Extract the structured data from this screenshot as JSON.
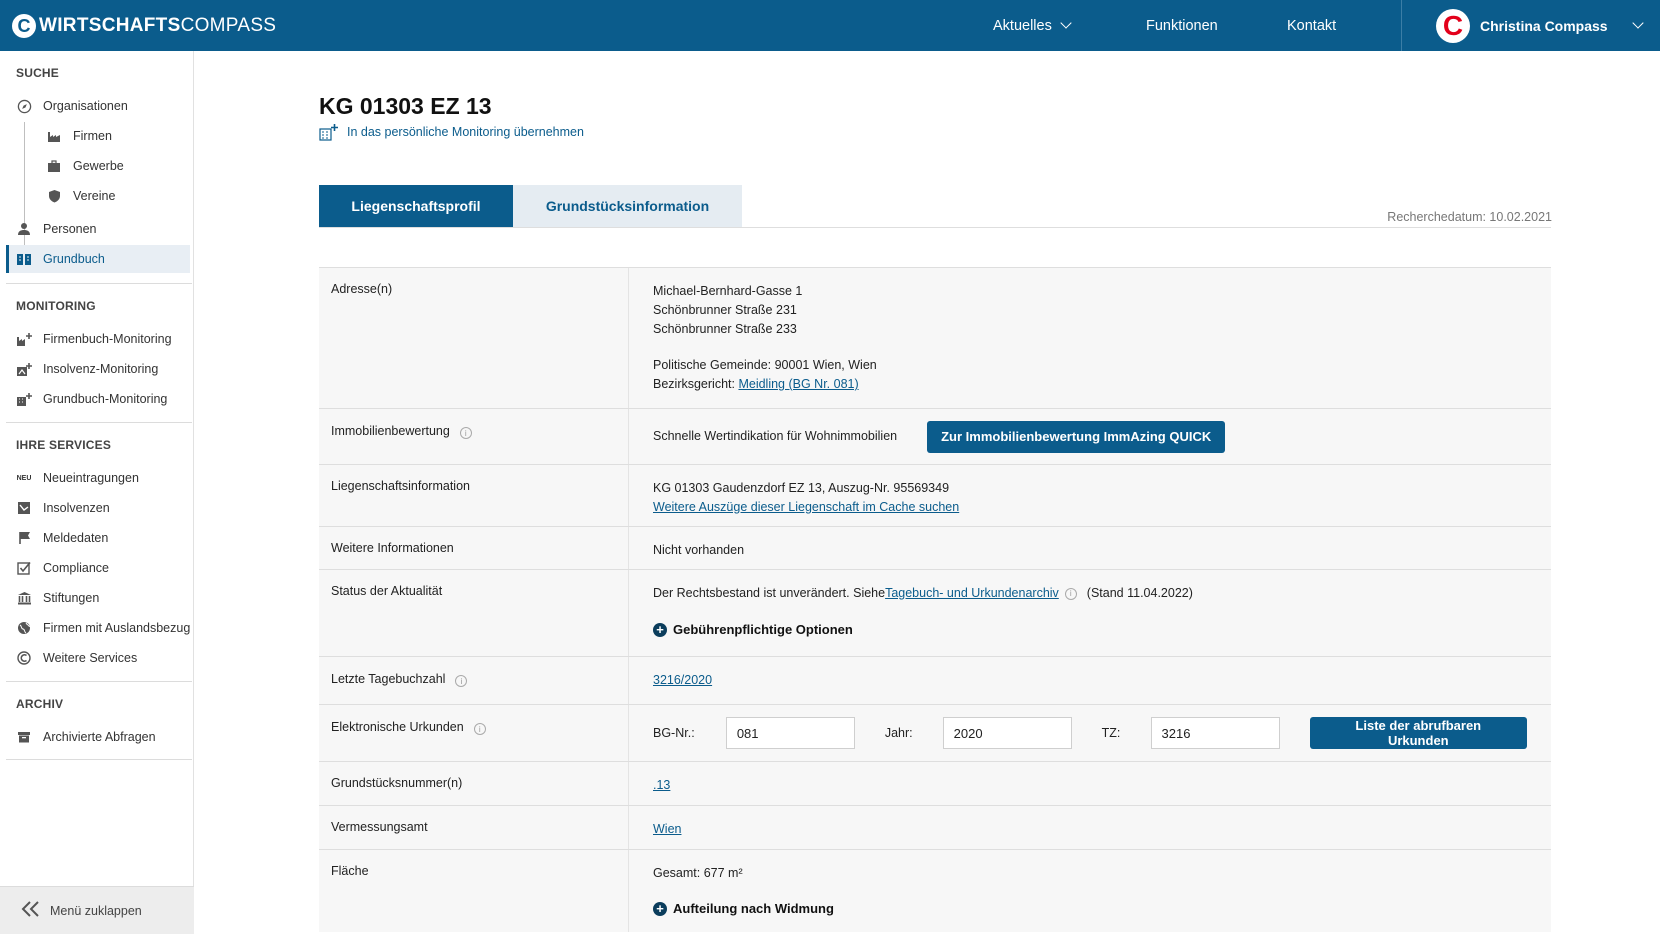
{
  "app": {
    "logo_bold": "WIRTSCHAFTS",
    "logo_light": "COMPASS",
    "logo_letter": "C"
  },
  "topnav": {
    "aktuelles": "Aktuelles",
    "funktionen": "Funktionen",
    "kontakt": "Kontakt"
  },
  "user": {
    "name": "Christina Compass",
    "avatar_letter": "C"
  },
  "sidebar": {
    "suche": "SUCHE",
    "organisationen": "Organisationen",
    "firmen": "Firmen",
    "gewerbe": "Gewerbe",
    "vereine": "Vereine",
    "personen": "Personen",
    "grundbuch": "Grundbuch",
    "monitoring": "MONITORING",
    "firmenbuch_monitoring": "Firmenbuch-Monitoring",
    "insolvenz_monitoring": "Insolvenz-Monitoring",
    "grundbuch_monitoring": "Grundbuch-Monitoring",
    "services": "IHRE SERVICES",
    "neu_badge": "NEU",
    "neueintragungen": "Neueintragungen",
    "insolvenzen": "Insolvenzen",
    "meldedaten": "Meldedaten",
    "compliance": "Compliance",
    "stiftungen": "Stiftungen",
    "auslandsbezug": "Firmen mit Auslandsbezug",
    "weitere_services": "Weitere Services",
    "archiv": "ARCHIV",
    "archivierte": "Archivierte Abfragen",
    "collapse": "Menü zuklappen"
  },
  "page": {
    "title": "KG 01303 EZ 13",
    "monitor_link": "In das persönliche Monitoring übernehmen",
    "tab_profil": "Liegenschaftsprofil",
    "tab_grund": "Grundstücksinformation",
    "research_date": "Recherchedatum: 10.02.2021"
  },
  "rows": {
    "adresse_label": "Adresse(n)",
    "addr1": "Michael-Bernhard-Gasse 1",
    "addr2": "Schönbrunner Straße 231",
    "addr3": "Schönbrunner Straße 233",
    "gemeinde": "Politische Gemeinde: 90001 Wien, Wien",
    "bezirk_prefix": "Bezirksgericht: ",
    "bezirk_link": "Meidling (BG Nr. 081)",
    "immo_label": "Immobilienbewertung",
    "immo_text": "Schnelle Wertindikation für Wohnimmobilien",
    "immo_btn": "Zur Immobilienbewertung ImmAzing QUICK",
    "liegen_label": "Liegenschaftsinformation",
    "liegen_text": "KG 01303 Gaudenzdorf EZ 13, Auszug-Nr. 95569349",
    "liegen_link": "Weitere Auszüge dieser Liegenschaft im Cache suchen",
    "weitere_label": "Weitere Informationen",
    "weitere_val": "Nicht vorhanden",
    "status_label": "Status der Aktualität",
    "status_prefix": "Der Rechtsbestand ist unverändert. Siehe ",
    "status_link": "Tagebuch- und Urkundenarchiv",
    "status_suffix": "(Stand 11.04.2022)",
    "gebuehr": "Gebührenpflichtige Optionen",
    "tagebuch_label": "Letzte Tagebuchzahl",
    "tagebuch_val": "3216/2020",
    "urkunden_label": "Elektronische Urkunden",
    "bg_label": "BG-Nr.:",
    "bg_val": "081",
    "jahr_label": "Jahr:",
    "jahr_val": "2020",
    "tz_label": "TZ:",
    "tz_val": "3216",
    "urkunden_btn": "Liste der abrufbaren Urkunden",
    "grundst_label": "Grundstücksnummer(n)",
    "grundst_val": ".13",
    "verm_label": "Vermessungsamt",
    "verm_val": "Wien",
    "flaeche_label": "Fläche",
    "flaeche_val": "Gesamt: 677 m²",
    "aufteilung": "Aufteilung nach Widmung"
  }
}
